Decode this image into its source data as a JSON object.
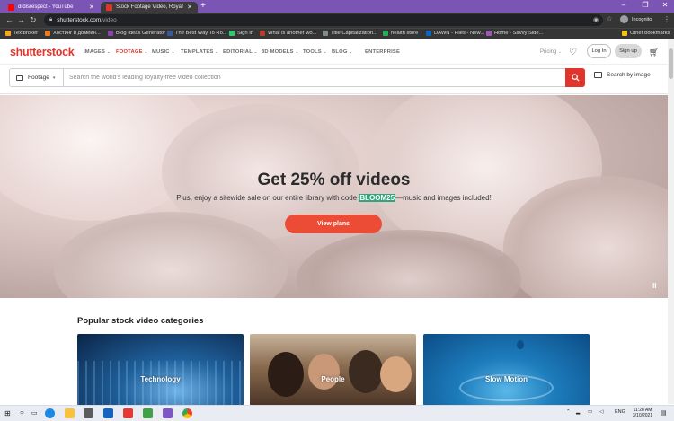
{
  "browser": {
    "tabs": [
      {
        "title": "drdisrespect - YouTube",
        "color": "#ff0000",
        "active": false
      },
      {
        "title": "Stock Footage Video, Royalty-Fr",
        "color": "#e1342b",
        "active": true
      }
    ],
    "new_tab": "+",
    "url_host": "shutterstock.com",
    "url_path": "/video",
    "profile_label": "Incognito",
    "bookmarks": [
      {
        "label": "Textbroker",
        "color": "#f5a623"
      },
      {
        "label": "Хостинг и домейн...",
        "color": "#e67e22"
      },
      {
        "label": "Blog Ideas Generator",
        "color": "#8e44ad"
      },
      {
        "label": "The Best Way To Ro...",
        "color": "#3b5998"
      },
      {
        "label": "Sign In",
        "color": "#2ecc71"
      },
      {
        "label": "What is another wo...",
        "color": "#c0392b"
      },
      {
        "label": "Title Capitalization...",
        "color": "#7f8c8d"
      },
      {
        "label": "health store",
        "color": "#27ae60"
      },
      {
        "label": "DAWN - Files - New...",
        "color": "#0a66c2"
      },
      {
        "label": "Home - Savvy Side...",
        "color": "#9b59b6"
      }
    ],
    "other_bookmarks": "Other bookmarks"
  },
  "site": {
    "logo": "shutterstock",
    "nav": [
      {
        "label": "IMAGES",
        "active": false
      },
      {
        "label": "FOOTAGE",
        "active": true
      },
      {
        "label": "MUSIC",
        "active": false
      },
      {
        "label": "TEMPLATES",
        "active": false
      },
      {
        "label": "EDITORIAL",
        "active": false
      },
      {
        "label": "3D MODELS",
        "active": false
      },
      {
        "label": "TOOLS",
        "active": false
      },
      {
        "label": "BLOG",
        "active": false
      },
      {
        "label": "ENTERPRISE",
        "active": false
      }
    ],
    "pricing": "Pricing",
    "login": "Log In",
    "signup": "Sign up"
  },
  "search": {
    "type": "Footage",
    "placeholder": "Search the world's leading royalty-free video collection",
    "by_image": "Search by image"
  },
  "hero": {
    "title": "Get 25% off videos",
    "subtitle_before": "Plus, enjoy a sitewide sale on our entire library with code ",
    "code": "BLOOM25",
    "subtitle_after": "—music and images included!",
    "cta": "View plans",
    "pause": "II"
  },
  "categories": {
    "title": "Popular stock video categories",
    "items": [
      {
        "label": "Technology"
      },
      {
        "label": "People"
      },
      {
        "label": "Slow Motion"
      }
    ]
  },
  "taskbar": {
    "lang": "ENG",
    "time": "11:28 AM",
    "date": "3/10/2021"
  },
  "colors": {
    "brand": "#e1342b",
    "cta": "#ec4b36",
    "code_highlight": "#36a47b"
  }
}
